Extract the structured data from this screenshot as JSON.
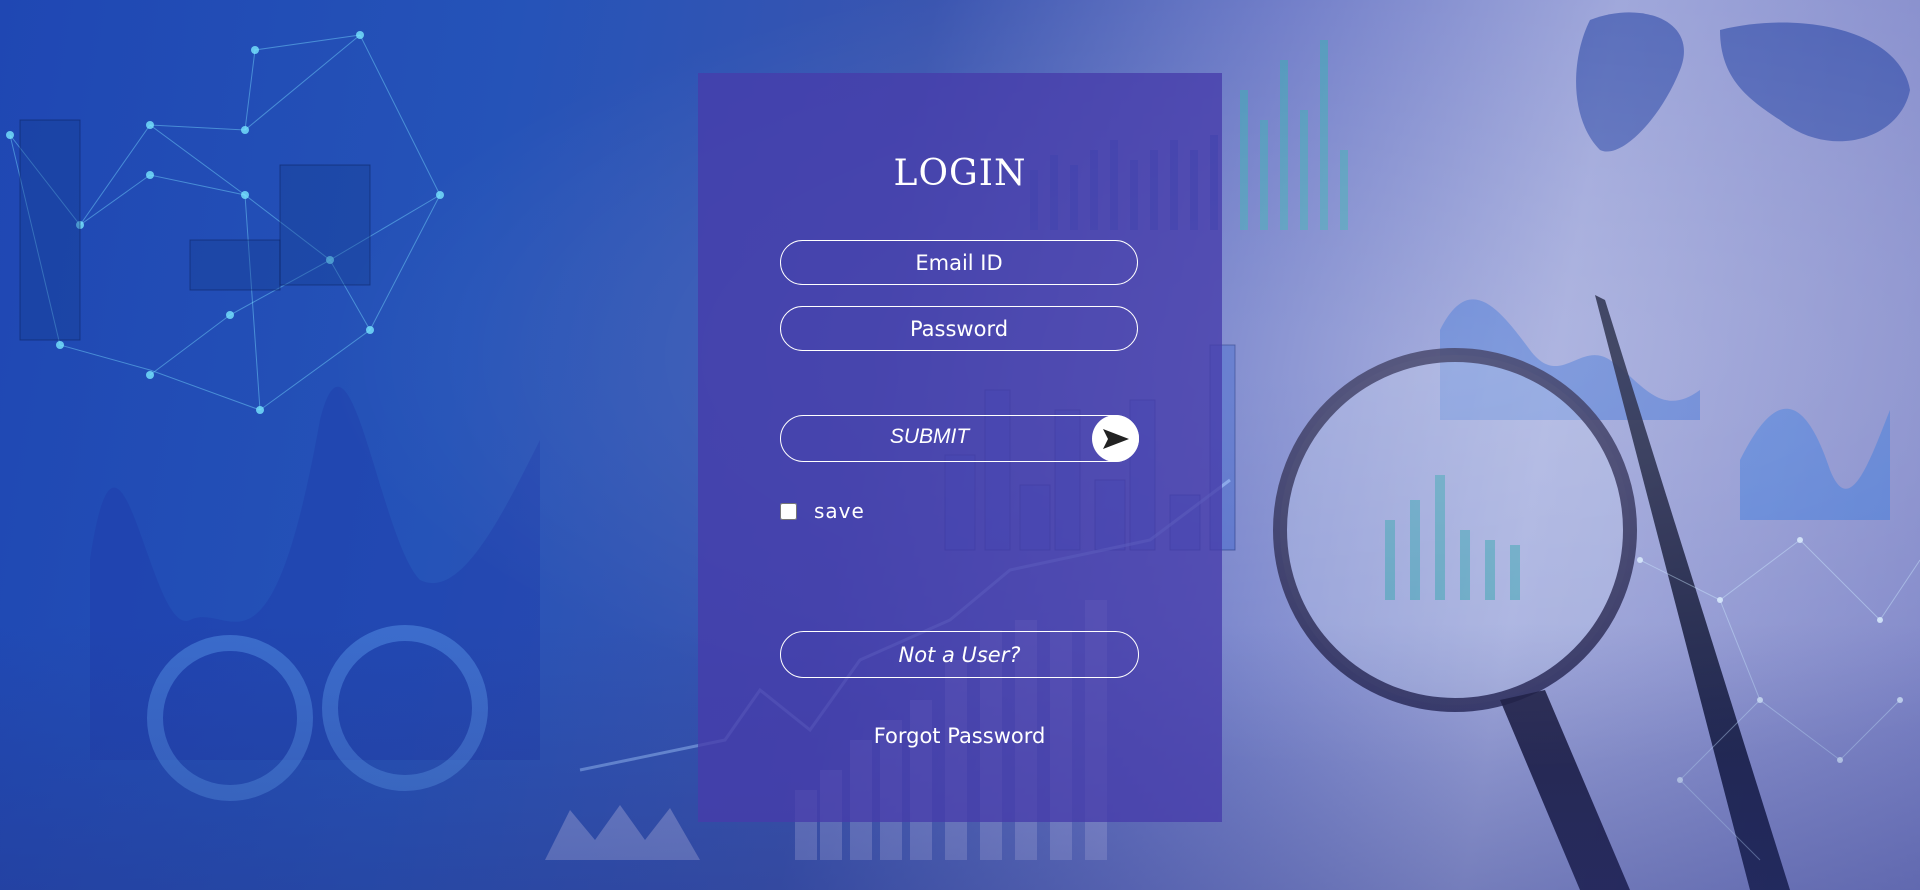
{
  "login": {
    "title": "LOGIN",
    "email_placeholder": "Email ID",
    "password_placeholder": "Password",
    "submit_label": "SUBMIT",
    "save_label": "save",
    "not_user_label": "Not a User?",
    "forgot_label": "Forgot Password"
  },
  "icons": {
    "submit": "send-arrow-icon"
  },
  "colors": {
    "panel": "#463caa",
    "accent": "#ffffff"
  }
}
